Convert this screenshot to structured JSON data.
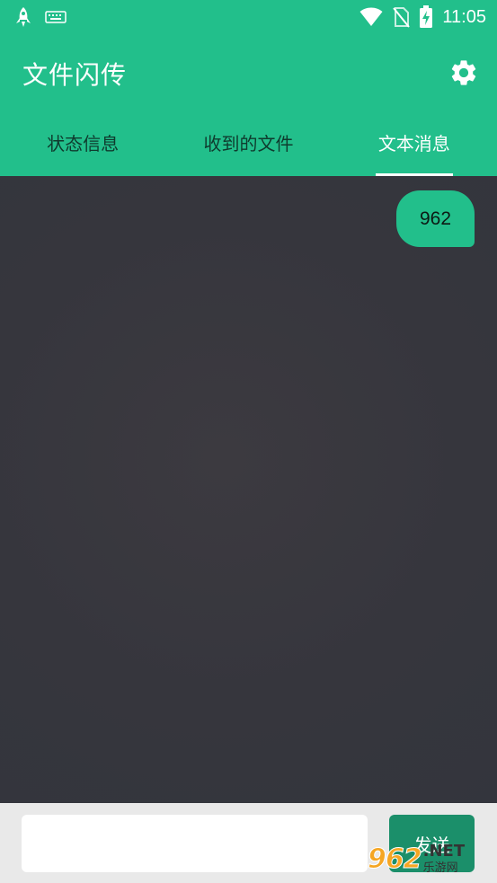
{
  "status_bar": {
    "time": "11:05",
    "icons": [
      "rocket-icon",
      "keyboard-icon",
      "wifi-icon",
      "no-sim-icon",
      "battery-charging-icon"
    ]
  },
  "app_bar": {
    "title": "文件闪传",
    "settings_icon": "gear-icon"
  },
  "tabs": [
    {
      "label": "状态信息",
      "active": false
    },
    {
      "label": "收到的文件",
      "active": false
    },
    {
      "label": "文本消息",
      "active": true
    }
  ],
  "messages": [
    {
      "text": "962",
      "from": "self"
    }
  ],
  "input": {
    "value": "",
    "send_label": "发送"
  },
  "watermark": {
    "num": "962",
    "net": ".NET",
    "sub": "乐游网"
  },
  "colors": {
    "accent": "#22bf8b",
    "chat_background": "#35363d",
    "send_button": "#1b8f6a"
  }
}
